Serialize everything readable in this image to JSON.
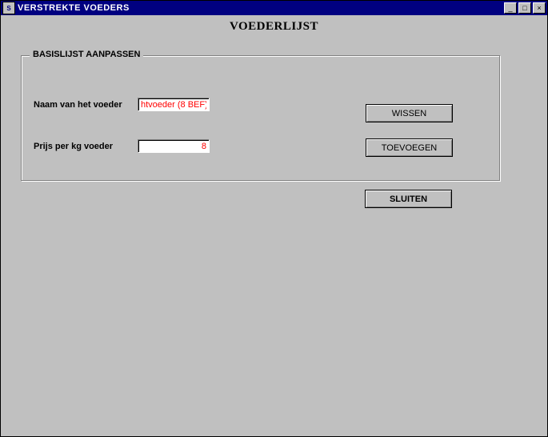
{
  "window": {
    "title": "VERSTREKTE VOEDERS"
  },
  "page": {
    "heading": "VOEDERLIJST"
  },
  "groupbox": {
    "title": "BASISLIJST AANPASSEN",
    "feed_name_label": "Naam van het voeder",
    "feed_name_value": "htvoeder (8 BEF)",
    "price_label": "Prijs per kg voeder",
    "price_value": "8"
  },
  "buttons": {
    "wissen": "WISSEN",
    "toevoegen": "TOEVOEGEN",
    "sluiten": "SLUITEN"
  }
}
